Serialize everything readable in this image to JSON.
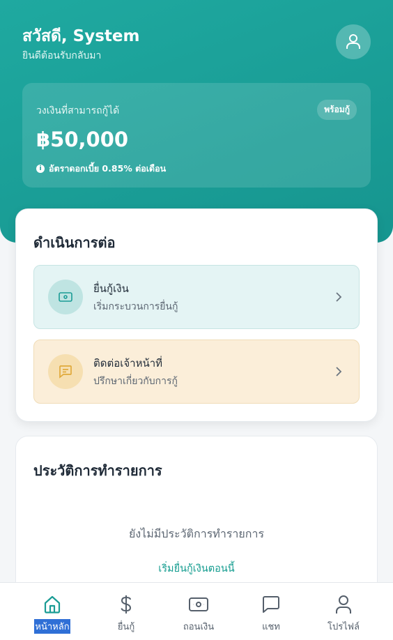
{
  "header": {
    "greeting": "สวัสดี, System",
    "subtitle": "ยินดีต้อนรับกลับมา"
  },
  "credit": {
    "label": "วงเงินที่สามารถกู้ได้",
    "badge": "พร้อมกู้",
    "amount": "฿50,000",
    "rate_text": "อัตราดอกเบี้ย 0.85% ต่อเดือน"
  },
  "continue_section": {
    "title": "ดำเนินการต่อ",
    "actions": [
      {
        "title": "ยื่นกู้เงิน",
        "subtitle": "เริ่มกระบวนการยื่นกู้",
        "icon": "banknote-icon"
      },
      {
        "title": "ติดต่อเจ้าหน้าที่",
        "subtitle": "ปรึกษาเกี่ยวกับการกู้",
        "icon": "chat-icon"
      }
    ]
  },
  "history": {
    "title": "ประวัติการทำรายการ",
    "empty_text": "ยังไม่มีประวัติการทำรายการ",
    "empty_link": "เริ่มยื่นกู้เงินตอนนี้"
  },
  "nav": {
    "items": [
      {
        "label": "หน้าหลัก",
        "icon": "home-icon",
        "active": true
      },
      {
        "label": "ยื่นกู้",
        "icon": "dollar-icon",
        "active": false
      },
      {
        "label": "ถอนเงิน",
        "icon": "banknote-icon",
        "active": false
      },
      {
        "label": "แชท",
        "icon": "chat-icon",
        "active": false
      },
      {
        "label": "โปรไฟล์",
        "icon": "user-icon",
        "active": false
      }
    ]
  },
  "colors": {
    "primary": "#1a9c95",
    "nav_active_highlight": "#2f6fd6",
    "warning_bg": "#fbeed9",
    "icon_gold": "#e0a93a"
  }
}
